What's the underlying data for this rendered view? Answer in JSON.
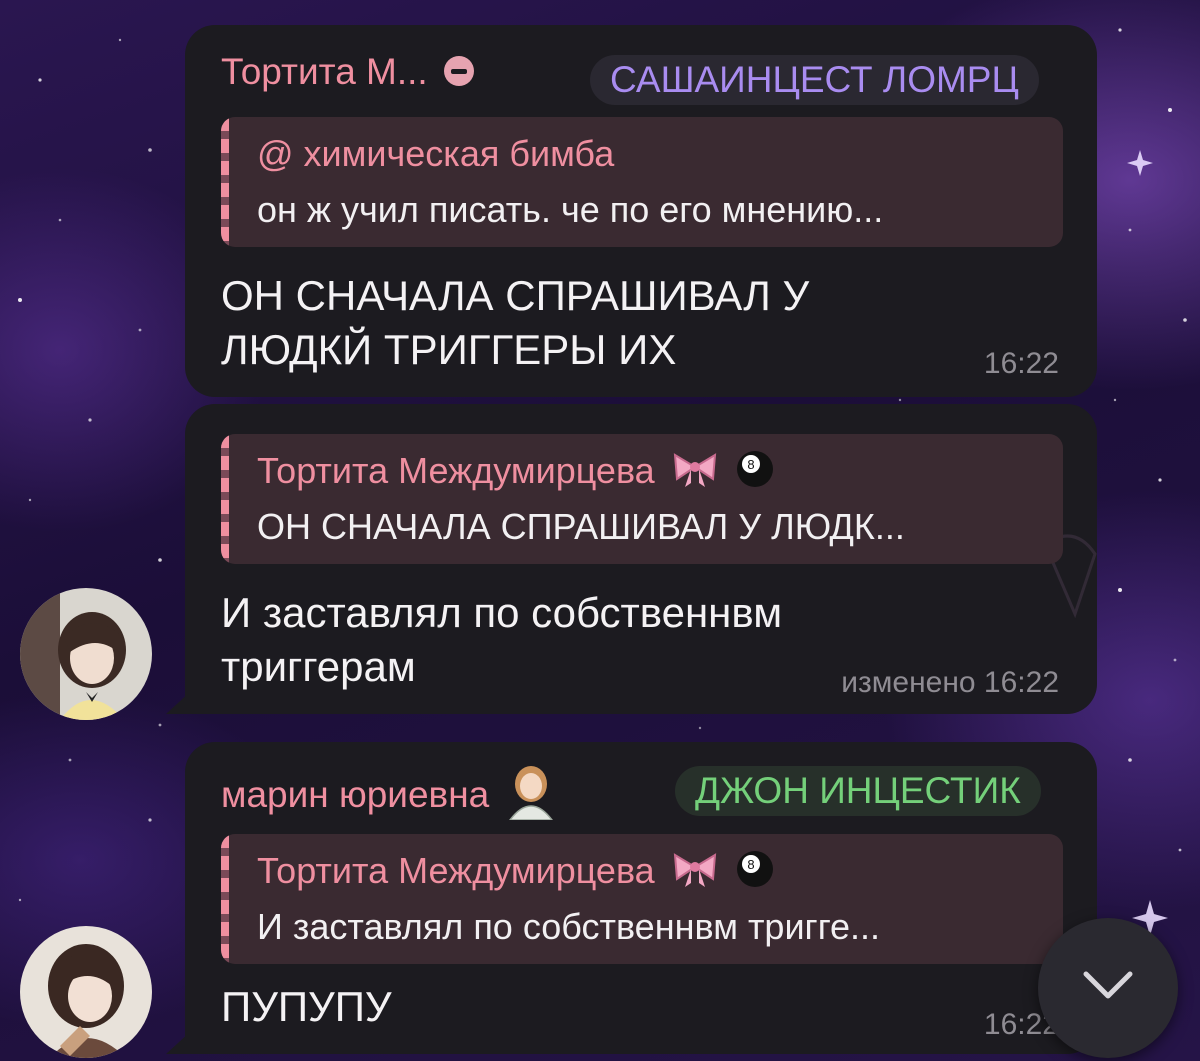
{
  "messages": [
    {
      "sender": "Тортита М...",
      "tag": "САШАИНЦЕСТ ЛОМРЦ",
      "reply_to": {
        "author": "@ химическая бимба",
        "text": "он ж учил писать. че по его мнению..."
      },
      "text": "ОН СНАЧАЛА СПРАШИВАЛ У\nЛЮДКЙ ТРИГГЕРЫ ИХ",
      "time": "16:22"
    },
    {
      "reply_to": {
        "author": "Тортита Междумирцева",
        "text": "ОН СНАЧАЛА СПРАШИВАЛ У ЛЮДК..."
      },
      "text": "И заставлял по собственнвм\nтриггерам",
      "time": "изменено 16:22"
    },
    {
      "sender": "марин юриевна",
      "tag": "ДЖОН ИНЦЕСТИК",
      "reply_to": {
        "author": "Тортита Междумирцева",
        "text": "И заставлял по собственнвм тригге..."
      },
      "text": "ПУПУПУ",
      "time": "16:22"
    }
  ],
  "icons": {
    "muted": "minus-circle-icon",
    "bow": "ribbon-bow-emoji",
    "ball": "8-ball-emoji",
    "person": "person-emoji",
    "scroll": "chevron-down-icon"
  },
  "colors": {
    "accent_pink": "#ef8fa0",
    "tag_purple": "#a98cf0",
    "tag_green": "#74d07a",
    "bubble": "#1c1b20"
  }
}
